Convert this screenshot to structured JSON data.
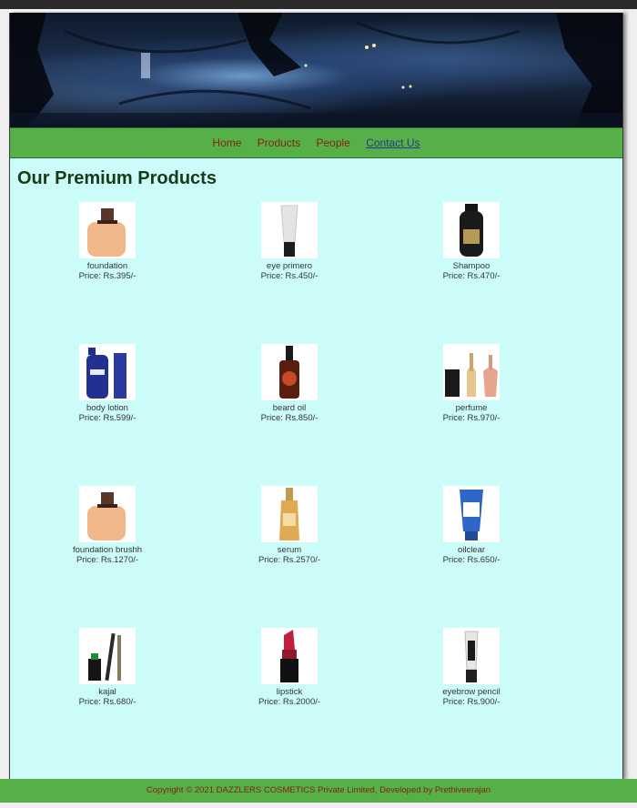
{
  "nav": {
    "items": [
      {
        "label": "Home"
      },
      {
        "label": "Products"
      },
      {
        "label": "People"
      },
      {
        "label": "Contact Us"
      }
    ]
  },
  "main": {
    "title": "Our Premium Products",
    "products": [
      {
        "name": "foundation",
        "price": "Price: Rs.395/-",
        "icon": "foundation-bottle"
      },
      {
        "name": "eye primero",
        "price": "Price: Rs.450/-",
        "icon": "primer-tube"
      },
      {
        "name": "Shampoo",
        "price": "Price: Rs.470/-",
        "icon": "shampoo-bottle"
      },
      {
        "name": "body lotion",
        "price": "Price: Rs.599/-",
        "icon": "lotion-bottle"
      },
      {
        "name": "beard oil",
        "price": "Price: Rs.850/-",
        "icon": "oil-dropper"
      },
      {
        "name": "perfume",
        "price": "Price: Rs.970/-",
        "icon": "perfume-bottles"
      },
      {
        "name": "foundation brushh",
        "price": "Price: Rs.1270/-",
        "icon": "foundation-bottle"
      },
      {
        "name": "serum",
        "price": "Price: Rs.2570/-",
        "icon": "serum-bottle"
      },
      {
        "name": "oilclear",
        "price": "Price: Rs.650/-",
        "icon": "facewash-tube"
      },
      {
        "name": "kajal",
        "price": "Price: Rs.680/-",
        "icon": "kajal-set"
      },
      {
        "name": "lipstick",
        "price": "Price: Rs.2000/-",
        "icon": "lipstick"
      },
      {
        "name": "eyebrow pencil",
        "price": "Price: Rs.900/-",
        "icon": "pencil-tube"
      }
    ]
  },
  "footer": {
    "text": "Copyright © 2021 DAZZLERS COSMETICS Private Limited, Developed by Prethiveerajan"
  },
  "colors": {
    "nav_bg": "#55b047",
    "content_bg": "#ccfcf9",
    "nav_link": "#8a1e12",
    "nav_link_visited": "#283593",
    "heading": "#173b17"
  }
}
